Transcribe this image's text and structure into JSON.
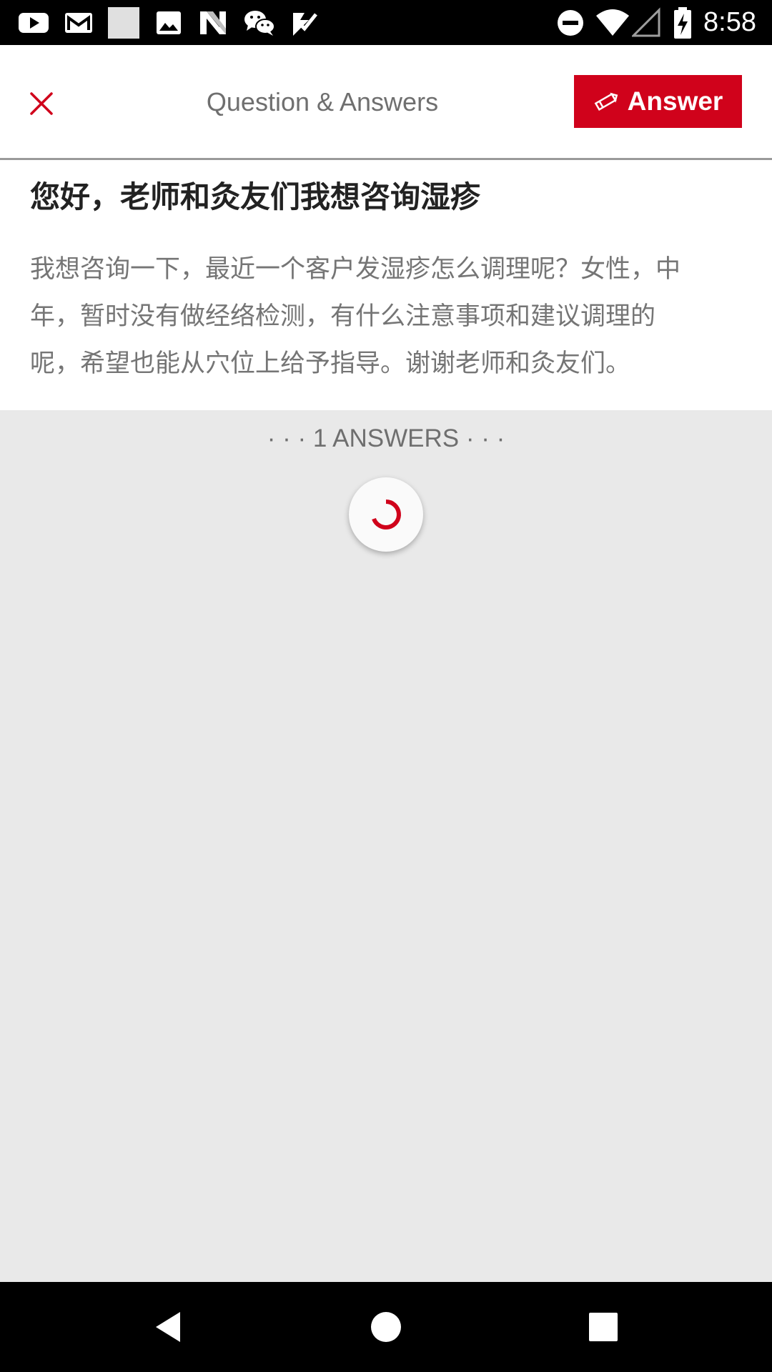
{
  "status_bar": {
    "time": "8:58",
    "left_icons": [
      "youtube-icon",
      "gmail-icon",
      "blank-notification-icon",
      "image-icon",
      "n-app-icon",
      "wechat-icon",
      "checkmark-app-icon"
    ],
    "right_icons": [
      "do-not-disturb-icon",
      "wifi-icon",
      "cell-signal-icon",
      "battery-charging-icon"
    ]
  },
  "app_bar": {
    "title": "Question & Answers",
    "answer_button_label": "Answer",
    "close_icon": "close-icon",
    "accent_color": "#d0021b"
  },
  "question": {
    "title": "您好，老师和灸友们我想咨询湿疹",
    "body_lines": [
      "我想咨询一下，最近一个客户发湿疹怎么调理呢？女性，中",
      "年，暂时没有做经络检测，有什么注意事项和建议调理的",
      "呢，希望也能从穴位上给予指导。谢谢老师和灸友们。"
    ]
  },
  "answers": {
    "count_label": "· · · 1 ANSWERS · · ·",
    "loading_icon": "loading-spinner-icon"
  },
  "nav_bar": {
    "icons": [
      "back-icon",
      "home-icon",
      "recents-icon"
    ]
  }
}
